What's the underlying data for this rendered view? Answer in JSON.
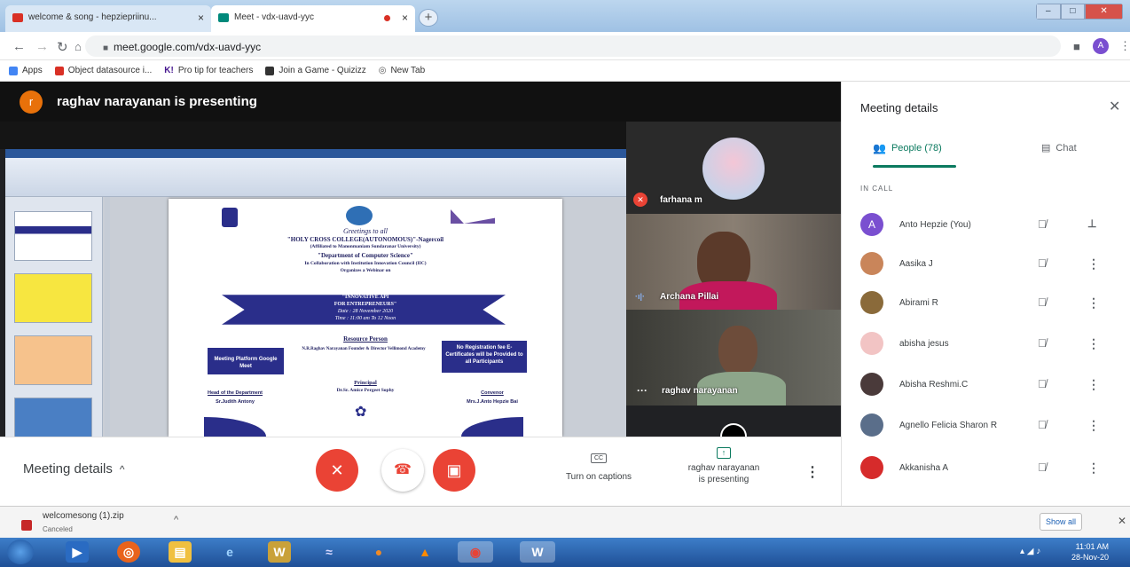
{
  "browser": {
    "tabs": [
      {
        "title": "welcome & song - hepziepriinu...",
        "close": "×"
      },
      {
        "title": "Meet - vdx-uavd-yyc",
        "close": "×"
      }
    ],
    "new_tab": "+",
    "url": "meet.google.com/vdx-uavd-yyc",
    "profile_initial": "A",
    "bookmarks": [
      "Apps",
      "Object datasource i...",
      "Pro tip for teachers",
      "Join a Game - Quizizz",
      "New Tab"
    ]
  },
  "presenting_banner": {
    "initial": "r",
    "text": "raghav narayanan is presenting"
  },
  "slide": {
    "greeting": "Greetings to all",
    "college": "\"HOLY CROSS COLLEGE(AUTONOMOUS)\"-Nagercoil",
    "affiliation": "(Affiliated to Manonmaniam Sundaranar University)",
    "department": "\"Department of Computer Science\"",
    "collab": "In Collaboration with Institution Innovation Council (IIC)",
    "organizes": "Organizes a Webinar on",
    "topic1": "\"INNOVATIVE API",
    "topic2": "FOR ENTREPRENEURS\"",
    "date": "Date : 28 November 2020",
    "time": "Time : 11:00 am To 12 Noon",
    "resource_heading": "Resource Person",
    "platform": "Meeting Platform Google Meet",
    "speaker": "N.R.Raghav Narayanan Founder & Director Vellimond Academy",
    "registration": "No Registration fee E-Certificates will be Provided to all Participants",
    "principal_heading": "Principal",
    "principal": "Dr.Sr. Amice Pergeet Sophy",
    "hod_heading": "Head of the Department",
    "hod": "Sr.Judith Antony",
    "convenor_heading": "Convenor",
    "convenor": "Mrs.J.Anto Hepzie Bai"
  },
  "participant_tiles": [
    {
      "name": "farhana m",
      "status": "mic-off"
    },
    {
      "name": "Archana Pillai",
      "status": "speaking"
    },
    {
      "name": "raghav narayanan",
      "status": "more"
    }
  ],
  "controls": {
    "meeting_details": "Meeting details",
    "captions": "Turn on captions",
    "captions_icon": "CC",
    "presenting_line1": "raghav narayanan",
    "presenting_line2": "is presenting"
  },
  "panel": {
    "title": "Meeting details",
    "people_tab": "People (78)",
    "chat_tab": "Chat",
    "section": "IN CALL",
    "people": [
      {
        "name": "Anto Hepzie (You)",
        "initial": "A",
        "color": "#7a4fd0"
      },
      {
        "name": "Aasika J",
        "initial": "",
        "color": "#c9855a"
      },
      {
        "name": "Abirami R",
        "initial": "",
        "color": "#8a6a3a"
      },
      {
        "name": "abisha jesus",
        "initial": "",
        "color": "#f2c4c4"
      },
      {
        "name": "Abisha Reshmi.C",
        "initial": "",
        "color": "#4a3a3a"
      },
      {
        "name": "Agnello Felicia Sharon R",
        "initial": "",
        "color": "#5a6e8a"
      },
      {
        "name": "Akkanisha A",
        "initial": "",
        "color": "#d62b2b"
      }
    ]
  },
  "download": {
    "filename": "welcomesong (1).zip",
    "status": "Canceled",
    "show_all": "Show all"
  },
  "taskbar": {
    "time": "11:01 AM",
    "date": "28-Nov-20"
  },
  "colors": {
    "meet_red": "#ea4335",
    "meet_green": "#0b7a5f",
    "taskbar_blue": "#1f4f96"
  }
}
